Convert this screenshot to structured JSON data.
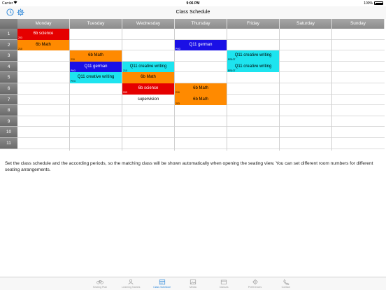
{
  "status_bar": {
    "carrier": "Carrier",
    "time": "9:06 PM",
    "battery": "100%"
  },
  "nav": {
    "title": "Class Schedule",
    "left_icons": [
      "clock-icon",
      "gear-icon"
    ]
  },
  "days": [
    "Monday",
    "Tuesday",
    "Wednesday",
    "Thursday",
    "Friday",
    "Saturday",
    "Sunday"
  ],
  "periods": [
    "1",
    "2",
    "3",
    "4",
    "5",
    "6",
    "7",
    "8",
    "9",
    "10",
    "11"
  ],
  "colors": {
    "red": "#e50000",
    "orange": "#ff8a00",
    "blue": "#1a10e6",
    "cyan": "#1de4ef",
    "header_gray": "#9a9a9a",
    "accent": "#2b86d9"
  },
  "lessons": [
    {
      "day": 0,
      "period": 1,
      "name": "6b science",
      "room": "203",
      "color": "red"
    },
    {
      "day": 0,
      "period": 2,
      "name": "6b Math",
      "room": "210",
      "color": "orange"
    },
    {
      "day": 1,
      "period": 3,
      "name": "6b Math",
      "room": "210",
      "color": "orange"
    },
    {
      "day": 1,
      "period": 4,
      "name": "Q11 german",
      "room": "PH3",
      "color": "blue"
    },
    {
      "day": 1,
      "period": 5,
      "name": "Q11 creative writing",
      "room": "PH3",
      "color": "cyan"
    },
    {
      "day": 2,
      "period": 4,
      "name": "Q11 creative writing",
      "room": "210",
      "color": "cyan"
    },
    {
      "day": 2,
      "period": 5,
      "name": "6b Math",
      "room": "",
      "color": "orange"
    },
    {
      "day": 2,
      "period": 6,
      "name": "6b science",
      "room": "203",
      "color": "red"
    },
    {
      "day": 2,
      "period": 7,
      "name": "supervision",
      "room": "",
      "color": "none"
    },
    {
      "day": 3,
      "period": 2,
      "name": "Q11 german",
      "room": "PH3",
      "color": "blue"
    },
    {
      "day": 3,
      "period": 6,
      "name": "6b Math",
      "room": "210",
      "color": "orange"
    },
    {
      "day": 3,
      "period": 7,
      "name": "6b Math",
      "room": "203",
      "color": "orange"
    },
    {
      "day": 4,
      "period": 3,
      "name": "Q11 creative writing",
      "room": "EB107",
      "color": "cyan"
    },
    {
      "day": 4,
      "period": 4,
      "name": "Q11 creative writing",
      "room": "EB107",
      "color": "cyan"
    }
  ],
  "info_text": "Set the class schedule and the according periods, so the matching class will be shown automatically when opening the seating view. You can set different room numbers for different seating arrangements.",
  "tabs": [
    {
      "label": "Seating Plan",
      "icon": "bicycle-icon",
      "active": false
    },
    {
      "label": "Learning Names",
      "icon": "person-icon",
      "active": false
    },
    {
      "label": "Class Schedule",
      "icon": "calendar-icon",
      "active": true
    },
    {
      "label": "Media",
      "icon": "image-icon",
      "active": false
    },
    {
      "label": "Classes",
      "icon": "folder-icon",
      "active": false
    },
    {
      "label": "Preferences",
      "icon": "gear-icon",
      "active": false
    },
    {
      "label": "Contact",
      "icon": "phone-icon",
      "active": false
    }
  ]
}
